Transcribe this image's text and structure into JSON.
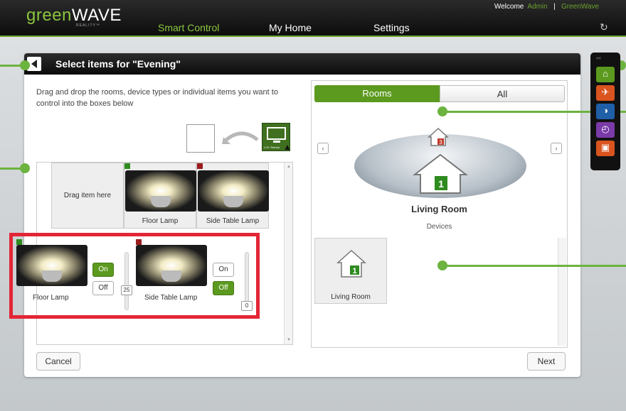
{
  "brand": {
    "name": "greenWAVE",
    "tagline": "REALITY™"
  },
  "nav": {
    "items": [
      "Smart Control",
      "My Home",
      "Settings"
    ],
    "active": "Smart Control"
  },
  "welcome": {
    "prefix": "Welcome",
    "user": "Admin",
    "separator": "|",
    "org": "GreenWave"
  },
  "panel": {
    "title": "Select items for \"Evening\"",
    "instructions": "Drag and drop the rooms, device types or individual items you want to control into the boxes below",
    "tv_caption": "LCD Televisi",
    "drag_here": "Drag item here",
    "tiles": [
      {
        "label": "Floor Lamp",
        "flag": "#2e8b1f"
      },
      {
        "label": "Side Table Lamp",
        "flag": "#9b1c1c"
      }
    ],
    "controls": [
      {
        "label": "Floor Lamp",
        "on": "On",
        "off": "Off",
        "state": "on",
        "level": "25",
        "flag": "#2e8b1f"
      },
      {
        "label": "Side Table Lamp",
        "on": "On",
        "off": "Off",
        "state": "off",
        "level": "0",
        "flag": "#9b1c1c"
      }
    ],
    "cancel": "Cancel",
    "next": "Next"
  },
  "right": {
    "tabs": [
      "Rooms",
      "All"
    ],
    "active_tab": "Rooms",
    "room": {
      "name": "Living Room",
      "sub": "Devices",
      "badge": "1",
      "top_badge": "3"
    },
    "room_tile": {
      "label": "Living Room",
      "badge": "1"
    }
  },
  "dock": {
    "collapse": "<<",
    "items": [
      "home-icon",
      "away-icon",
      "night-icon",
      "clock-icon",
      "tv-icon"
    ]
  },
  "colors": {
    "accent": "#5c9a1f",
    "callout": "#6cb33f",
    "highlight": "#e32636"
  }
}
